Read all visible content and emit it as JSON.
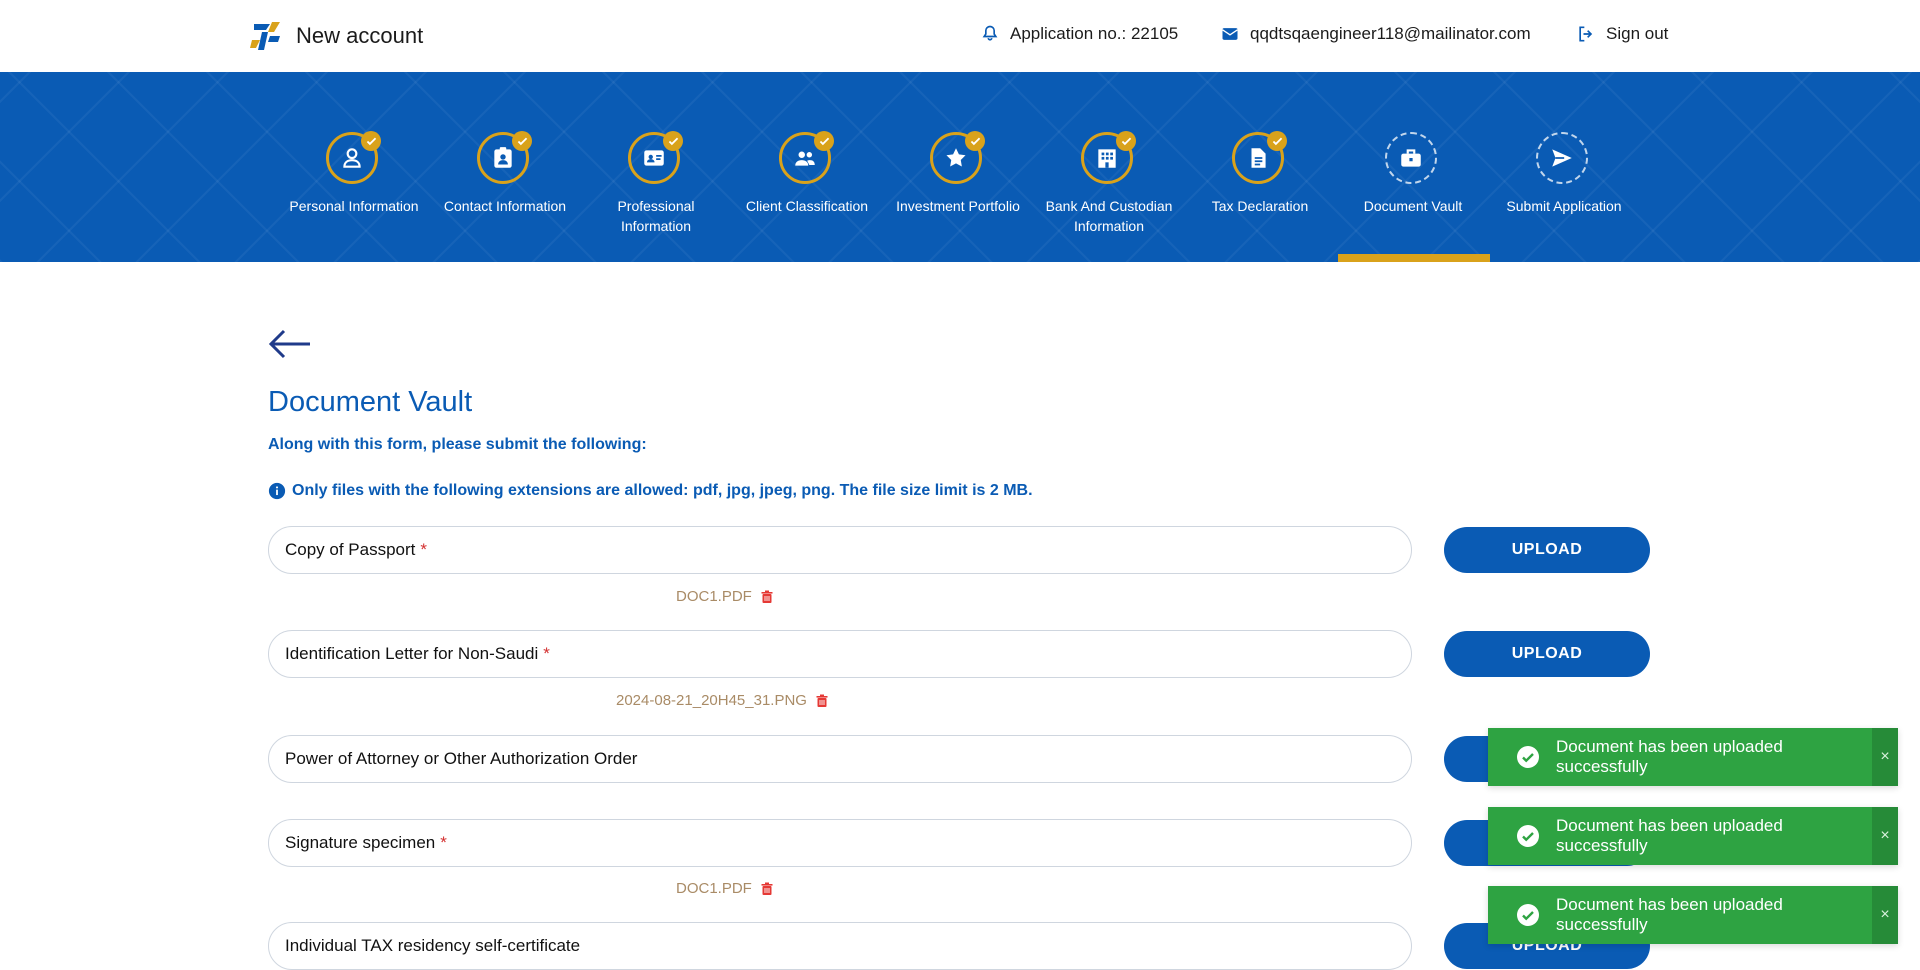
{
  "header": {
    "app_title": "New account",
    "application_no": "Application no.: 22105",
    "email": "qqdtsqaengineer118@mailinator.com",
    "sign_out": "Sign out"
  },
  "steps": [
    {
      "label": "Personal Information",
      "status": "completed",
      "icon": "user-icon"
    },
    {
      "label": "Contact Information",
      "status": "completed",
      "icon": "contact-card-icon"
    },
    {
      "label": "Professional Information",
      "status": "completed",
      "icon": "id-card-icon"
    },
    {
      "label": "Client Classification",
      "status": "completed",
      "icon": "users-icon"
    },
    {
      "label": "Investment Portfolio",
      "status": "completed",
      "icon": "star-icon"
    },
    {
      "label": "Bank And Custodian Information",
      "status": "completed",
      "icon": "building-icon"
    },
    {
      "label": "Tax Declaration",
      "status": "completed",
      "icon": "document-icon"
    },
    {
      "label": "Document Vault",
      "status": "active",
      "icon": "briefcase-icon"
    },
    {
      "label": "Submit Application",
      "status": "pending",
      "icon": "send-icon"
    }
  ],
  "main": {
    "title": "Document Vault",
    "subtitle": "Along with this form, please submit the following:",
    "info": "Only files with the following extensions are allowed: pdf, jpg, jpeg, png. The file size limit is 2 MB.",
    "upload_label": "UPLOAD",
    "documents": [
      {
        "label": "Copy of Passport",
        "required": "*",
        "file": "DOC1.PDF"
      },
      {
        "label": "Identification Letter for Non-Saudi",
        "required": "*",
        "file": "2024-08-21_20H45_31.PNG"
      },
      {
        "label": "Power of Attorney or Other Authorization Order",
        "required": "",
        "file": ""
      },
      {
        "label": "Signature specimen",
        "required": "*",
        "file": "DOC1.PDF"
      },
      {
        "label": "Individual TAX residency self-certificate",
        "required": "",
        "file": ""
      }
    ]
  },
  "toasts": [
    {
      "message": "Document has been uploaded successfully",
      "close": "×"
    },
    {
      "message": "Document has been uploaded successfully",
      "close": "×"
    },
    {
      "message": "Document has been uploaded successfully",
      "close": "×"
    }
  ],
  "colors": {
    "primary": "#0a5bb4",
    "accent": "#d9a21b",
    "success": "#2ea342",
    "danger": "#d32f2f"
  }
}
